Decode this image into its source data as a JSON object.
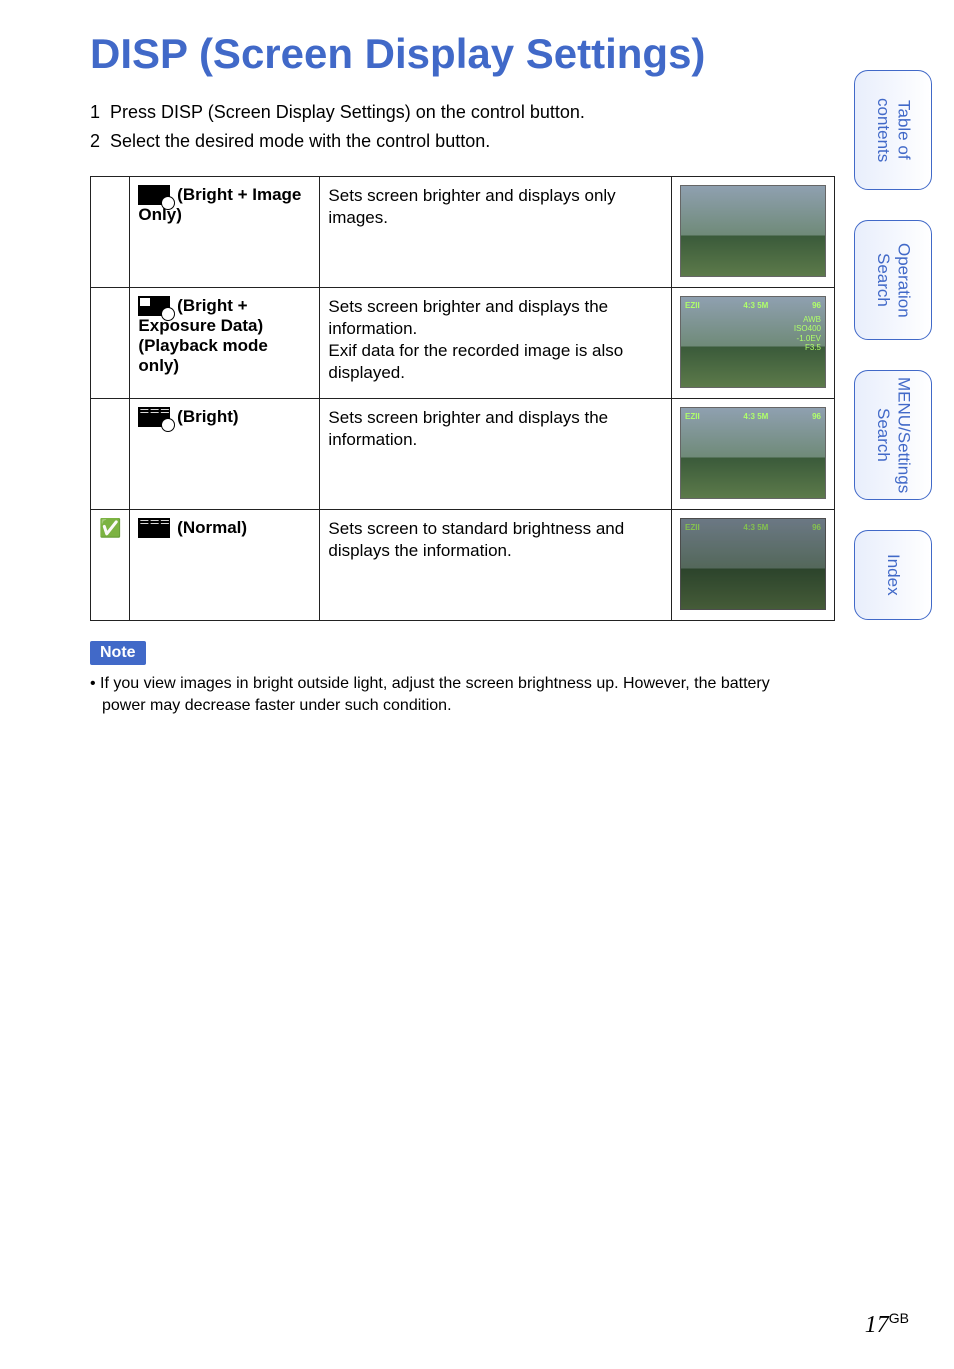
{
  "title": "DISP (Screen Display Settings)",
  "steps": [
    {
      "num": "1",
      "text": "Press DISP (Screen Display Settings) on the control button."
    },
    {
      "num": "2",
      "text": "Select the desired mode with the control button."
    }
  ],
  "modes": [
    {
      "checked": "",
      "label_prefix": "(Bright + Image Only)",
      "icon_type": "plain",
      "desc": "Sets screen brighter and displays only images.",
      "overlay": "none"
    },
    {
      "checked": "",
      "label_prefix": "(Bright + Exposure Data) (Playback mode only)",
      "icon_type": "exposure",
      "desc": "Sets screen brighter and displays the information.\nExif data for the recorded image is also displayed.",
      "overlay": "full"
    },
    {
      "checked": "",
      "label_prefix": "(Bright)",
      "icon_type": "lines",
      "desc": "Sets screen brighter and displays the information.",
      "overlay": "basic"
    },
    {
      "checked": "✅",
      "label_prefix": "(Normal)",
      "icon_type": "lines-dark",
      "desc": "Sets screen to standard brightness and displays the information.",
      "overlay": "basic-dark"
    }
  ],
  "note_label": "Note",
  "note_text": "• If you view images in bright outside light, adjust the screen brightness up. However, the battery power may decrease faster under such condition.",
  "tabs": [
    "Table of contents",
    "Operation Search",
    "MENU/Settings Search",
    "Index"
  ],
  "page_number": "17",
  "page_suffix": "GB",
  "thumb_overlay": {
    "left_badge": "EZII",
    "mid_badge": "4:3 5M",
    "count": "96",
    "exp_lines": [
      "AWB",
      "ISO400",
      "-1.0EV",
      "F3.5"
    ]
  }
}
